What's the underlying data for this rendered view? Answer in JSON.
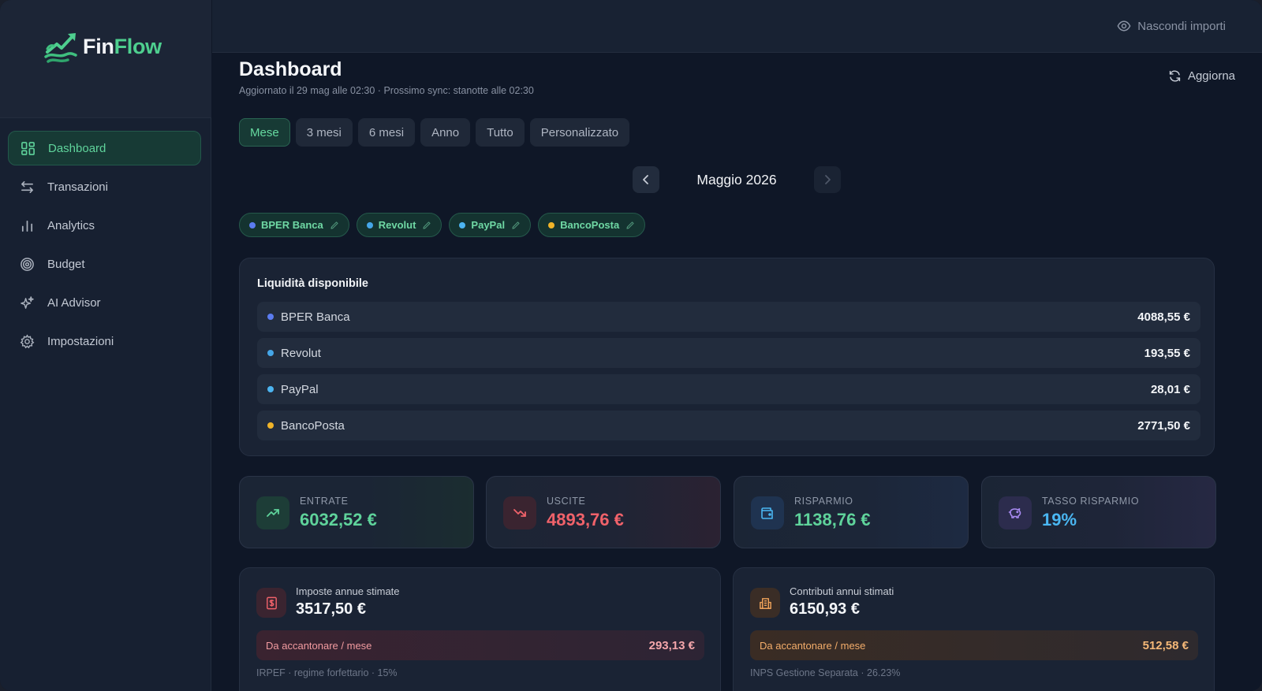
{
  "brand": {
    "name_part1": "Fin",
    "name_part2": "Flow"
  },
  "nav": {
    "items": [
      {
        "label": "Dashboard",
        "icon": "grid-icon",
        "active": true
      },
      {
        "label": "Transazioni",
        "icon": "arrows-swap-icon"
      },
      {
        "label": "Analytics",
        "icon": "bar-chart-icon"
      },
      {
        "label": "Budget",
        "icon": "target-icon"
      },
      {
        "label": "AI Advisor",
        "icon": "sparkles-icon"
      },
      {
        "label": "Impostazioni",
        "icon": "gear-icon"
      }
    ]
  },
  "topbar": {
    "hide_amounts_label": "Nascondi importi",
    "icon": "eye-icon"
  },
  "header": {
    "title": "Dashboard",
    "subtitle": "Aggiornato il 29 mag alle 02:30 · Prossimo sync: stanotte alle 02:30",
    "refresh_label": "Aggiorna"
  },
  "periods": {
    "items": [
      {
        "label": "Mese",
        "active": true
      },
      {
        "label": "3 mesi"
      },
      {
        "label": "6 mesi"
      },
      {
        "label": "Anno"
      },
      {
        "label": "Tutto"
      },
      {
        "label": "Personalizzato"
      }
    ]
  },
  "month_nav": {
    "label": "Maggio 2026"
  },
  "accounts": [
    {
      "name": "BPER Banca",
      "color": "#5b7cf0",
      "balance": "4088,55 €"
    },
    {
      "name": "Revolut",
      "color": "#45a6e8",
      "balance": "193,55 €"
    },
    {
      "name": "PayPal",
      "color": "#4cb4f0",
      "balance": "28,01 €"
    },
    {
      "name": "BancoPosta",
      "color": "#f0b429",
      "balance": "2771,50 €"
    }
  ],
  "liquidity": {
    "title": "Liquidità disponibile"
  },
  "stats": [
    {
      "label": "ENTRATE",
      "value": "6032,52 €",
      "icon": "trend-up-icon",
      "color": "#5fd39b"
    },
    {
      "label": "USCITE",
      "value": "4893,76 €",
      "icon": "trend-down-icon",
      "color": "#f0626a"
    },
    {
      "label": "RISPARMIO",
      "value": "1138,76 €",
      "icon": "wallet-icon",
      "color": "#5fd39b"
    },
    {
      "label": "TASSO RISPARMIO",
      "value": "19%",
      "icon": "piggy-bank-icon",
      "color": "#4ab7f2"
    }
  ],
  "taxes": {
    "label": "Imposte annue stimate",
    "value": "3517,50 €",
    "monthly_label": "Da accantonare / mese",
    "monthly_value": "293,13 €",
    "note": "IRPEF · regime forfettario · 15%",
    "icon": "receipt-icon"
  },
  "contributions": {
    "label": "Contributi annui stimati",
    "value": "6150,93 €",
    "monthly_label": "Da accantonare / mese",
    "monthly_value": "512,58 €",
    "note": "INPS Gestione Separata · 26.23%",
    "icon": "building-icon"
  }
}
